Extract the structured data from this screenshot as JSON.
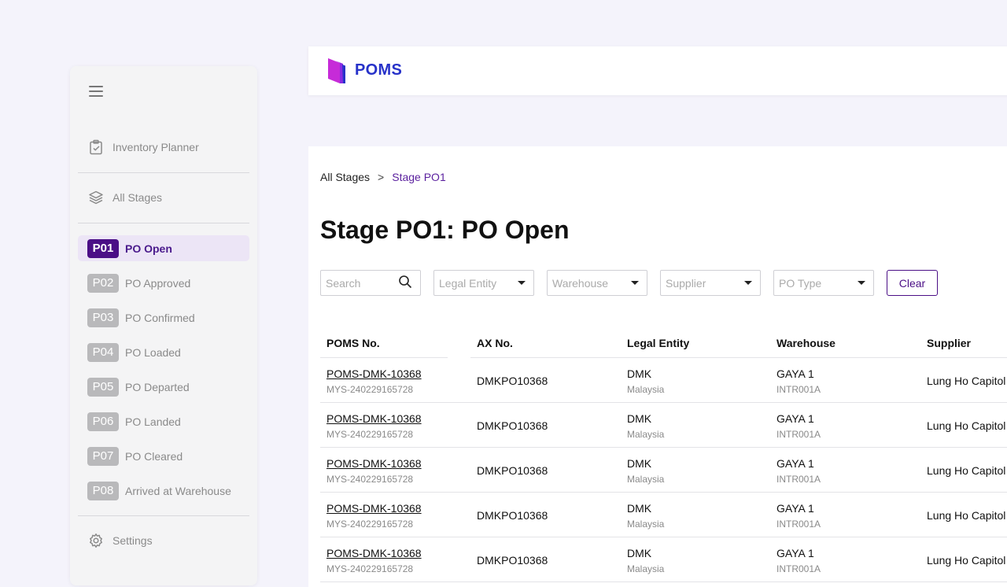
{
  "app": {
    "brand": "POMS",
    "brand_color": "#2732c9",
    "accent": "#4b0f86"
  },
  "sidebar": {
    "menu_icon": "hamburger-icon",
    "top_items": [
      {
        "label": "Inventory Planner",
        "icon": "clipboard-check-icon"
      },
      {
        "label": "All Stages",
        "icon": "layers-icon"
      }
    ],
    "stages": [
      {
        "code": "P01",
        "label": "PO Open",
        "active": true
      },
      {
        "code": "P02",
        "label": "PO Approved"
      },
      {
        "code": "P03",
        "label": "PO Confirmed"
      },
      {
        "code": "P04",
        "label": "PO Loaded"
      },
      {
        "code": "P05",
        "label": "PO Departed"
      },
      {
        "code": "P06",
        "label": "PO Landed"
      },
      {
        "code": "P07",
        "label": "PO Cleared"
      },
      {
        "code": "P08",
        "label": "Arrived at Warehouse"
      }
    ],
    "settings": {
      "label": "Settings",
      "icon": "gear-icon"
    }
  },
  "breadcrumb": {
    "root": "All Stages",
    "separator": ">",
    "current": "Stage PO1"
  },
  "page_title": "Stage PO1: PO Open",
  "filters": {
    "search_placeholder": "Search",
    "legal_entity": "Legal Entity",
    "warehouse": "Warehouse",
    "supplier": "Supplier",
    "po_type": "PO Type",
    "clear_label": "Clear"
  },
  "table": {
    "columns": [
      "POMS No.",
      "AX No.",
      "Legal Entity",
      "Warehouse",
      "Supplier"
    ],
    "rows": [
      {
        "poms_no": "POMS-DMK-10368",
        "poms_sub": "MYS-240229165728",
        "ax_no": "DMKPO10368",
        "entity": "DMK",
        "entity_sub": "Malaysia",
        "warehouse": "GAYA 1",
        "warehouse_sub": "INTR001A",
        "supplier": "Lung Ho Capitol"
      },
      {
        "poms_no": "POMS-DMK-10368",
        "poms_sub": "MYS-240229165728",
        "ax_no": "DMKPO10368",
        "entity": "DMK",
        "entity_sub": "Malaysia",
        "warehouse": "GAYA 1",
        "warehouse_sub": "INTR001A",
        "supplier": "Lung Ho Capitol"
      },
      {
        "poms_no": "POMS-DMK-10368",
        "poms_sub": "MYS-240229165728",
        "ax_no": "DMKPO10368",
        "entity": "DMK",
        "entity_sub": "Malaysia",
        "warehouse": "GAYA 1",
        "warehouse_sub": "INTR001A",
        "supplier": "Lung Ho Capitol"
      },
      {
        "poms_no": "POMS-DMK-10368",
        "poms_sub": "MYS-240229165728",
        "ax_no": "DMKPO10368",
        "entity": "DMK",
        "entity_sub": "Malaysia",
        "warehouse": "GAYA 1",
        "warehouse_sub": "INTR001A",
        "supplier": "Lung Ho Capitol"
      },
      {
        "poms_no": "POMS-DMK-10368",
        "poms_sub": "MYS-240229165728",
        "ax_no": "DMKPO10368",
        "entity": "DMK",
        "entity_sub": "Malaysia",
        "warehouse": "GAYA 1",
        "warehouse_sub": "INTR001A",
        "supplier": "Lung Ho Capitol"
      }
    ]
  }
}
